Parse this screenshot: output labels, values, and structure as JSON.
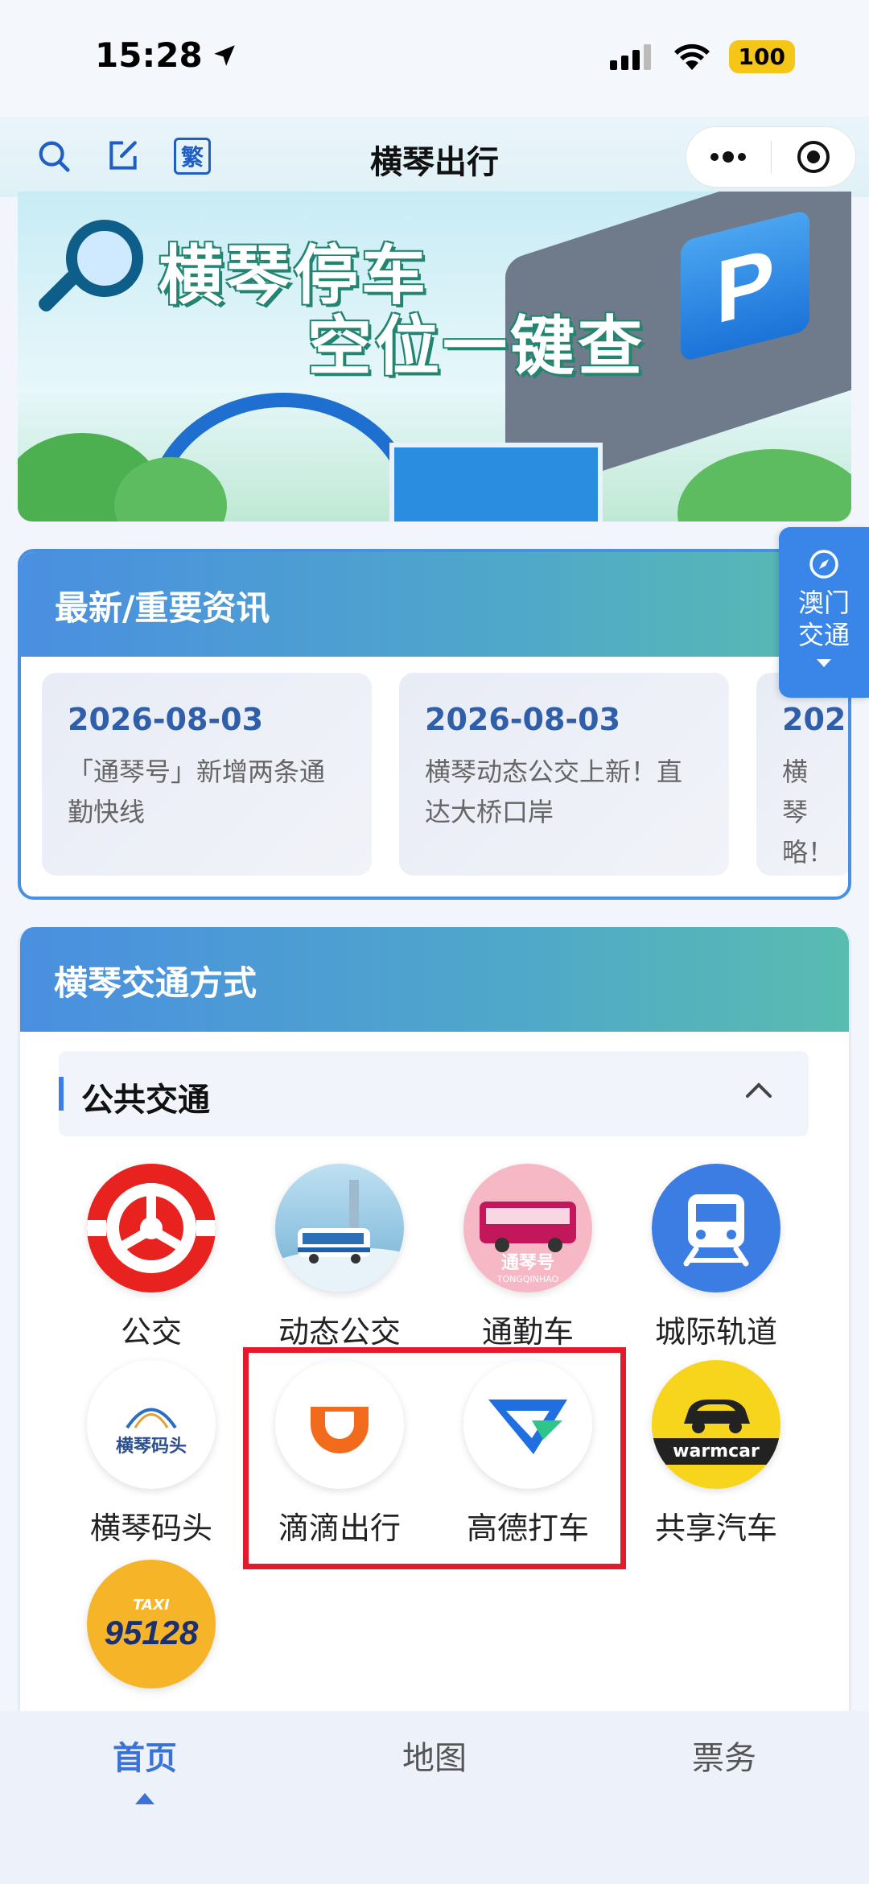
{
  "status_bar": {
    "time": "15:28",
    "battery": "100"
  },
  "header": {
    "title": "横琴出行",
    "traditional_toggle": "繁"
  },
  "banner": {
    "line1": "横琴停车",
    "line2": "空位一键查",
    "parking_letter": "P"
  },
  "side_tab": {
    "label": "澳门交通"
  },
  "news": {
    "title": "最新/重要资讯",
    "items": [
      {
        "date": "2026-08-03",
        "text": "「通琴号」新增两条通勤快线"
      },
      {
        "date": "2026-08-03",
        "text": "横琴动态公交上新！直达大桥口岸"
      },
      {
        "date": "202",
        "text": "横琴略！"
      }
    ]
  },
  "transport": {
    "title": "横琴交通方式",
    "category": "公共交通",
    "items": [
      {
        "label": "公交",
        "icon": "bus-wheel-icon"
      },
      {
        "label": "动态公交",
        "icon": "dynamic-bus-icon"
      },
      {
        "label": "通勤车",
        "icon": "commuter-bus-icon",
        "badge": "通琴号",
        "badge_sub": "TONGQINHAO"
      },
      {
        "label": "城际轨道",
        "icon": "train-icon"
      },
      {
        "label": "横琴码头",
        "icon": "ferry-terminal-icon",
        "logo_text": "横琴码头"
      },
      {
        "label": "滴滴出行",
        "icon": "didi-icon"
      },
      {
        "label": "高德打车",
        "icon": "amap-taxi-icon"
      },
      {
        "label": "共享汽车",
        "icon": "warmcar-icon",
        "logo_text": "warmcar"
      },
      {
        "label": "",
        "icon": "taxi-95128-icon",
        "logo_top": "TAXI",
        "logo_num": "95128"
      }
    ]
  },
  "tabbar": {
    "tabs": [
      "首页",
      "地图",
      "票务"
    ],
    "active": "首页"
  },
  "colors": {
    "accent": "#3a72d6",
    "highlight": "#e21a2c",
    "didi": "#f26b1d",
    "amap": "#1f6fe0"
  }
}
